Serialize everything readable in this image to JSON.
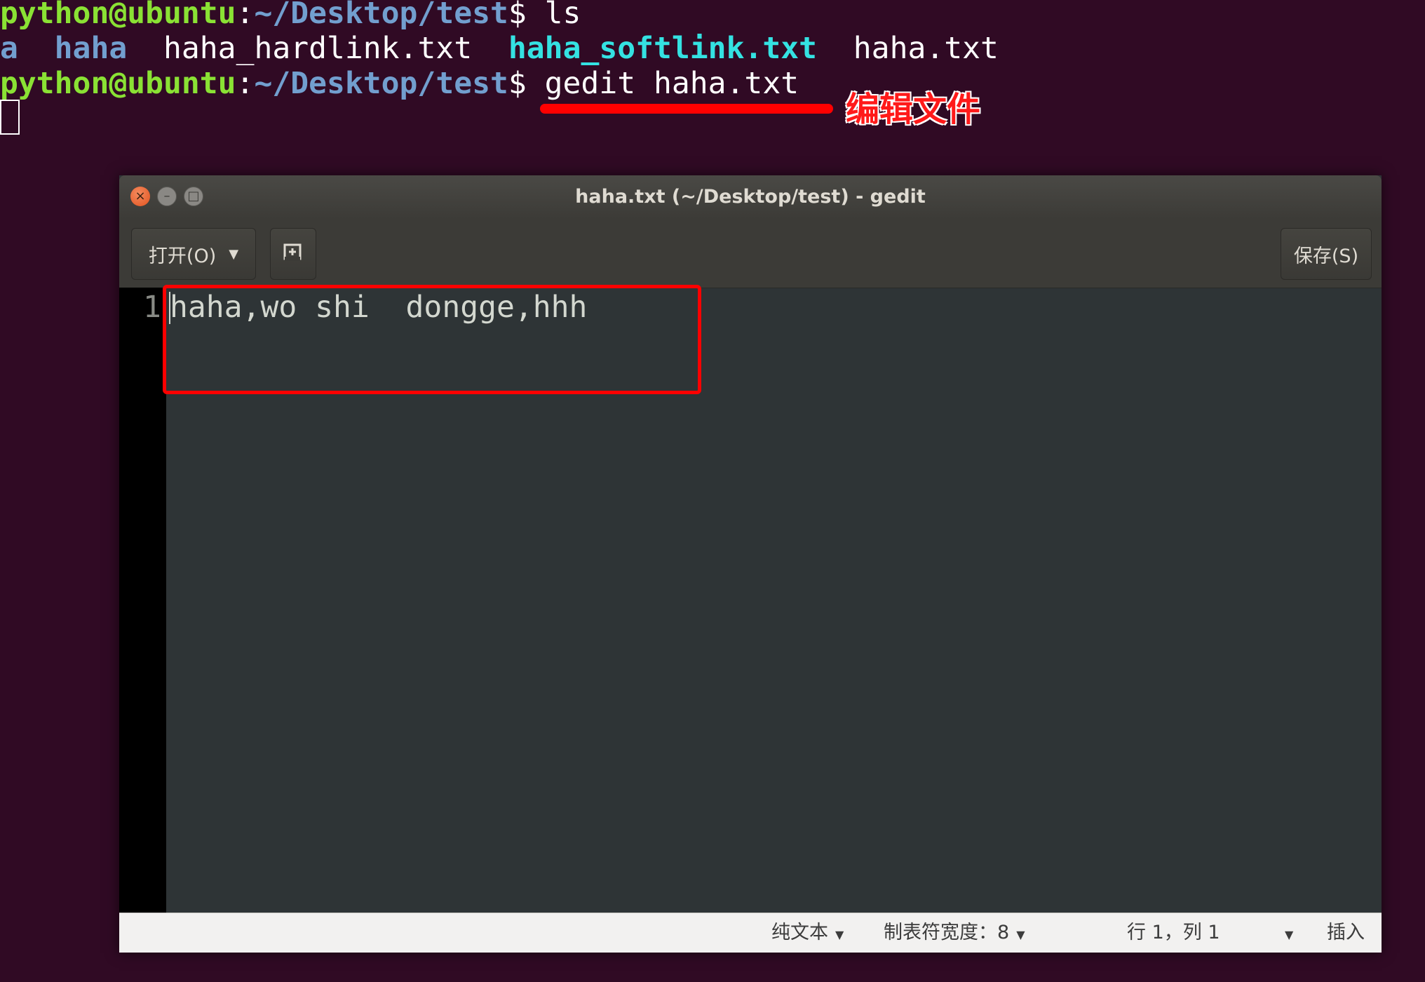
{
  "terminal": {
    "line1": {
      "user": "python@ubuntu",
      "path": "~/Desktop/test",
      "command": "ls"
    },
    "listing": {
      "item_a": "a",
      "item_haha": "haha",
      "item_hardlink": "haha_hardlink.txt",
      "item_softlink": "haha_softlink.txt",
      "item_txt": "haha.txt"
    },
    "line3": {
      "user": "python@ubuntu",
      "path": "~/Desktop/test",
      "command": "gedit haha.txt"
    }
  },
  "annotation": {
    "label": "编辑文件",
    "color": "#ff0000"
  },
  "gedit": {
    "title": "haha.txt (~/Desktop/test) - gedit",
    "toolbar": {
      "open_label": "打开(O)",
      "save_label": "保存(S)"
    },
    "editor": {
      "line_number": "1",
      "content": "haha,wo shi  dongge,hhh"
    },
    "statusbar": {
      "language": "纯文本",
      "tab_width": "制表符宽度：8",
      "position": "行 1，列 1",
      "mode": "插入"
    }
  },
  "icons": {
    "close": "close-icon",
    "minimize": "minimize-icon",
    "maximize": "maximize-icon",
    "new_tab": "new-tab-icon",
    "dropdown": "chevron-down-icon"
  },
  "colors": {
    "terminal_bg": "#300a24",
    "prompt_user": "#8ae234",
    "prompt_path": "#729fcf",
    "link": "#34e2e2",
    "editor_bg": "#2e3436"
  }
}
